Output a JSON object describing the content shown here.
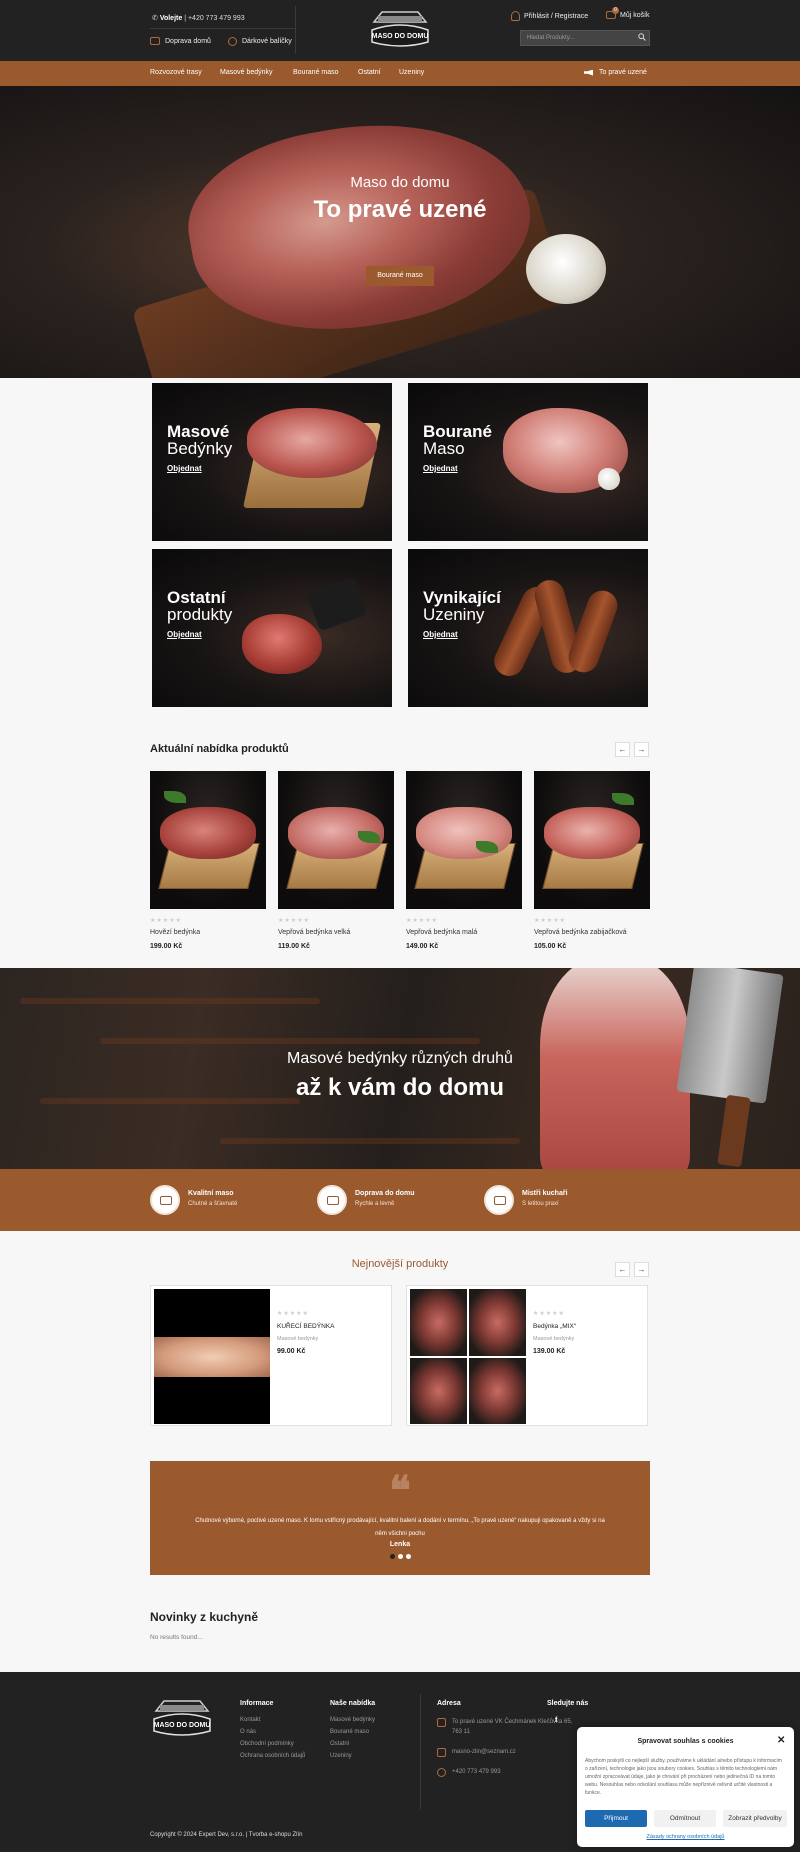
{
  "header": {
    "phone_label": "Volejte",
    "phone_number": "+420 773 479 993",
    "delivery_link": "Doprava domů",
    "gift_link": "Dárkové balíčky",
    "logo_text": "MASO DO DOMU",
    "account_link": "Přihlásit / Registrace",
    "cart_label": "Můj košík",
    "cart_count": "0",
    "search_placeholder": "Hledat Produkty..."
  },
  "nav": {
    "items": [
      "Rozvozové trasy",
      "Masové bedýnky",
      "Bourané maso",
      "Ostatní",
      "Uzeniny"
    ],
    "right_item": "To pravé uzené"
  },
  "hero": {
    "subtitle": "Maso do domu",
    "title": "To pravé uzené",
    "button": "Bourané maso"
  },
  "categories": [
    {
      "line1": "Masové",
      "line2": "Bedýnky",
      "cta": "Objednat"
    },
    {
      "line1": "Bourané",
      "line2": "Maso",
      "cta": "Objednat"
    },
    {
      "line1": "Ostatní",
      "line2": "produkty",
      "cta": "Objednat"
    },
    {
      "line1": "Vynikající",
      "line2": "Uzeniny",
      "cta": "Objednat"
    }
  ],
  "current_offer": {
    "title": "Aktuální nabídka produktů",
    "prev": "←",
    "next": "→",
    "stars": "★★★★★",
    "products": [
      {
        "name": "Hovězí bedýnka",
        "price": "199.00 Kč"
      },
      {
        "name": "Vepřová bedýnka velká",
        "price": "119.00 Kč"
      },
      {
        "name": "Vepřová bedýnka malá",
        "price": "149.00 Kč"
      },
      {
        "name": "Vepřová bedýnka zabijačková",
        "price": "105.00 Kč"
      }
    ]
  },
  "promo": {
    "subtitle": "Masové bedýnky různých druhů",
    "title": "až k vám do domu"
  },
  "features": [
    {
      "title": "Kvalitní maso",
      "subtitle": "Chutné a šťavnaté"
    },
    {
      "title": "Doprava do domu",
      "subtitle": "Rychle a levně"
    },
    {
      "title": "Mistři kuchaři",
      "subtitle": "S letitou praxí"
    }
  ],
  "newest": {
    "title": "Nejnovější produkty",
    "prev": "←",
    "next": "→",
    "stars": "★★★★★",
    "products": [
      {
        "name": "KUŘECÍ BEDÝNKA",
        "category": "Masové bedýnky",
        "price": "99.00 Kč"
      },
      {
        "name": "Bedýnka „MIX“",
        "category": "Masové bedýnky",
        "price": "139.00 Kč"
      }
    ]
  },
  "testimonial": {
    "quote_mark": "❝",
    "text": "Chutnové výborné, poctivé uzené maso. K tomu vstřícný prodávající, kvalitní balení a dodání v termínu. „To pravé uzené“ nakupuji opakovaně a vždy si na něm všichni pochu",
    "author": "Lenka"
  },
  "news": {
    "title": "Novinky z kuchyně",
    "empty": "No results found..."
  },
  "footer": {
    "logo_text": "MASO DO DOMU",
    "info_head": "Informace",
    "info_links": [
      "Kontakt",
      "O nás",
      "Obchodní podmínky",
      "Ochrana osobních údajů"
    ],
    "offer_head": "Naše nabídka",
    "offer_links": [
      "Masové bedýnky",
      "Bourané maso",
      "Ostatní",
      "Uzeniny"
    ],
    "address_head": "Adresa",
    "address_lines": [
      "To pravé uzené VK Čechmánek Klečůvka 65,",
      "763 11"
    ],
    "email": "masno-zlin@seznam.cz",
    "phone": "+420 773 479 993",
    "follow_head": "Sledujte nás",
    "facebook": "f",
    "copyright": "Copyright © 2024 Expert Dev, s.r.o. | Tvorba e-shopu Zlín"
  },
  "cookie": {
    "title": "Spravovat souhlas s cookies",
    "close": "✕",
    "text": "Abychom poskytli co nejlepší služby, používáme k ukládání a/nebo přístupu k informacím o zařízení, technologie jako jsou soubory cookies. Souhlas s těmito technologiemi nám umožní zpracovávat údaje, jako je chování při procházení nebo jedinečná ID na tomto webu. Nesouhlas nebo odvolání souhlasu může nepříznivě ovlivnit určité vlastnosti a funkce.",
    "accept": "Přijmout",
    "deny": "Odmítnout",
    "prefs": "Zobrazit předvolby",
    "policy": "Zásady ochrany osobních údajů"
  },
  "colors": {
    "brand": "#9a5a2e",
    "dark": "#222222",
    "cookie_button": "#1e6ab0"
  }
}
